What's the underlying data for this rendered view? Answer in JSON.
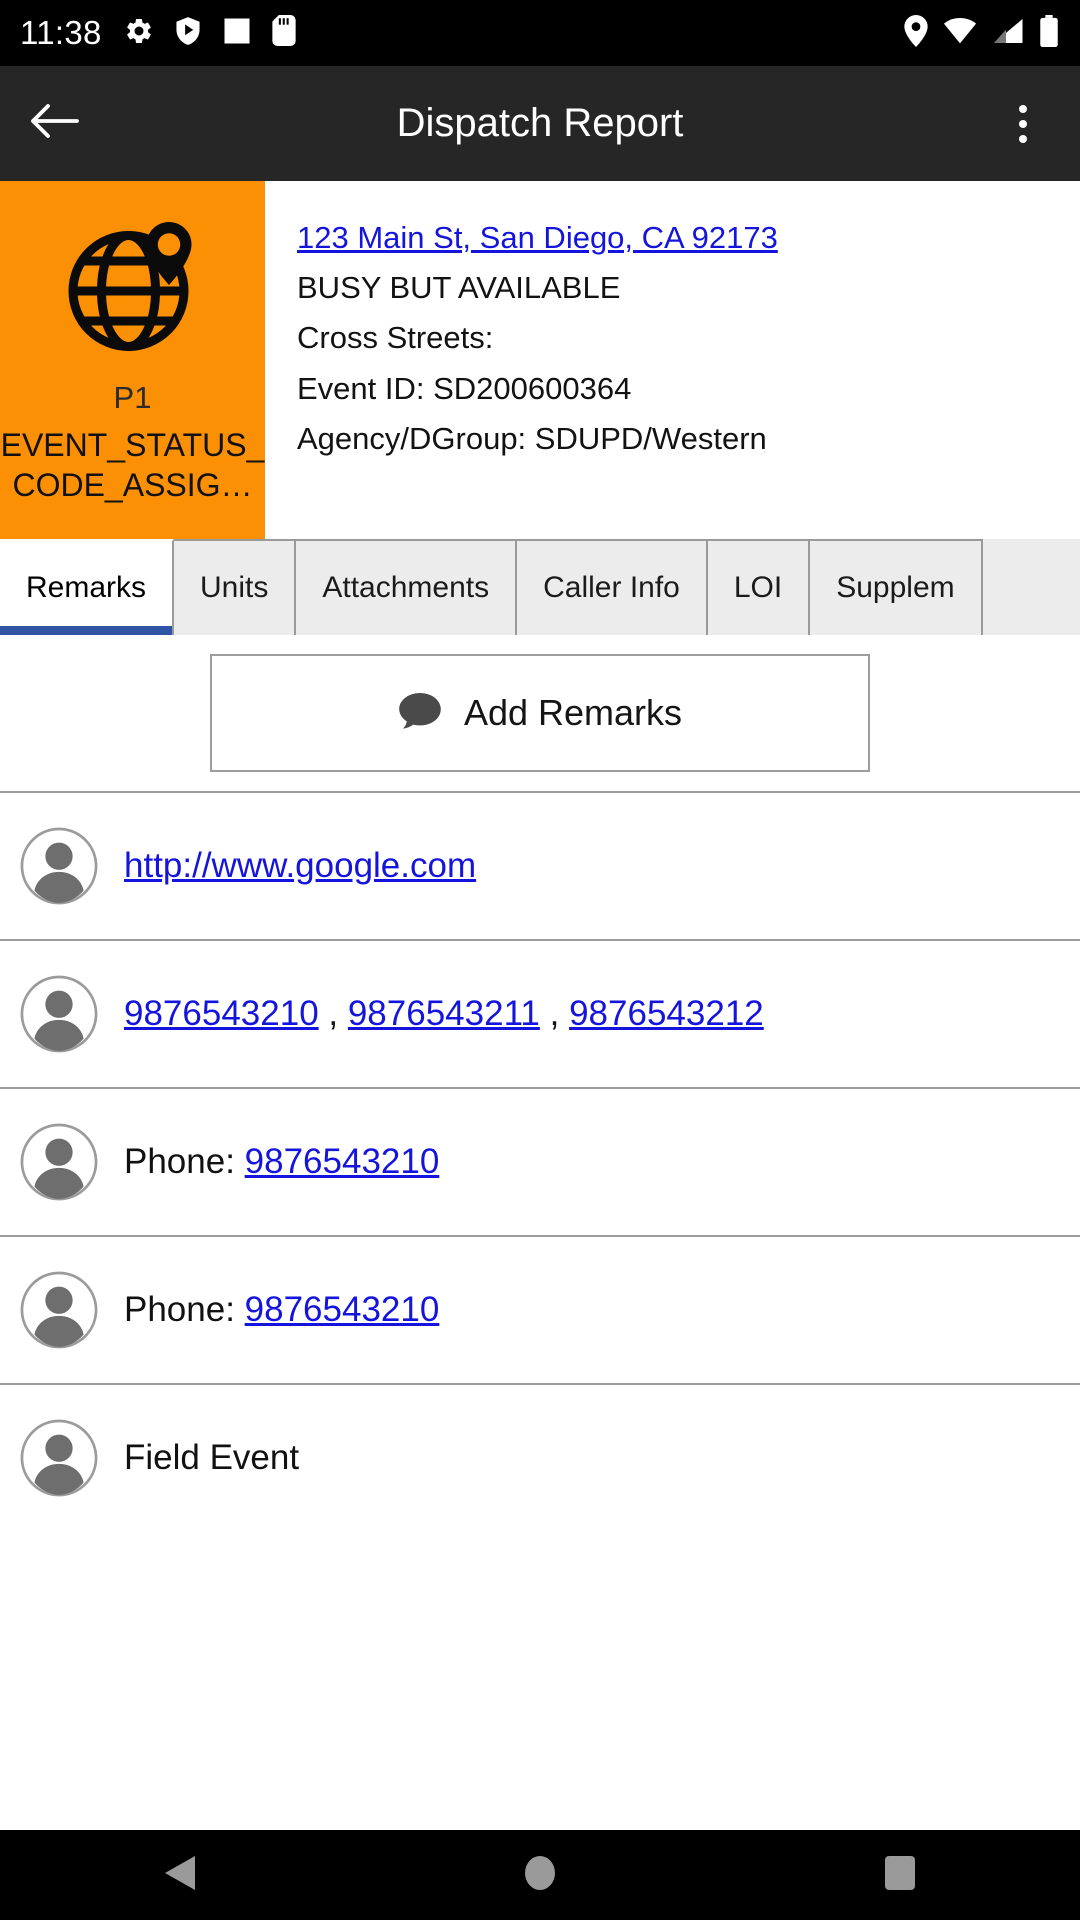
{
  "status_bar": {
    "time": "11:38",
    "left_icons": [
      "gear-icon",
      "play-protect-icon",
      "square-icon",
      "sd-card-icon"
    ],
    "right_icons": [
      "location-icon",
      "wifi-icon",
      "cellular-signal-icon",
      "battery-icon"
    ]
  },
  "app_bar": {
    "back_label": "back-arrow",
    "title": "Dispatch Report",
    "overflow_label": "more-options"
  },
  "event": {
    "priority": "P1",
    "status_code": "EVENT_STATUS_CODE_ASSIG…",
    "icon": "globe-location-icon",
    "accent_color": "#FB9004",
    "address": "123 Main St, San Diego, CA 92173",
    "availability": "BUSY BUT AVAILABLE",
    "cross_streets_label": "Cross Streets:",
    "event_id_line": "Event ID:  SD200600364",
    "agency_line": "Agency/DGroup: SDUPD/Western"
  },
  "tabs": [
    {
      "label": "Remarks",
      "active": true
    },
    {
      "label": "Units",
      "active": false
    },
    {
      "label": "Attachments",
      "active": false
    },
    {
      "label": "Caller Info",
      "active": false
    },
    {
      "label": "LOI",
      "active": false
    },
    {
      "label": "Supplem",
      "active": false
    }
  ],
  "add_remarks": {
    "label": "Add Remarks",
    "icon": "comment-bubble-icon"
  },
  "remarks": [
    {
      "icon": "avatar-icon",
      "parts": [
        {
          "text": "http://www.google.com",
          "link": true
        }
      ]
    },
    {
      "icon": "avatar-icon",
      "parts": [
        {
          "text": "9876543210",
          "link": true
        },
        {
          "text": " , ",
          "link": false
        },
        {
          "text": "9876543211",
          "link": true
        },
        {
          "text": " , ",
          "link": false
        },
        {
          "text": "9876543212",
          "link": true
        }
      ]
    },
    {
      "icon": "avatar-icon",
      "parts": [
        {
          "text": "Phone: ",
          "link": false
        },
        {
          "text": "9876543210",
          "link": true
        }
      ]
    },
    {
      "icon": "avatar-icon",
      "parts": [
        {
          "text": "Phone: ",
          "link": false
        },
        {
          "text": "9876543210",
          "link": true
        }
      ]
    },
    {
      "icon": "avatar-icon",
      "parts": [
        {
          "text": "Field Event",
          "link": false
        }
      ]
    }
  ],
  "nav_bar": {
    "back": "nav-back-icon",
    "home": "nav-home-icon",
    "recents": "nav-recents-icon"
  }
}
